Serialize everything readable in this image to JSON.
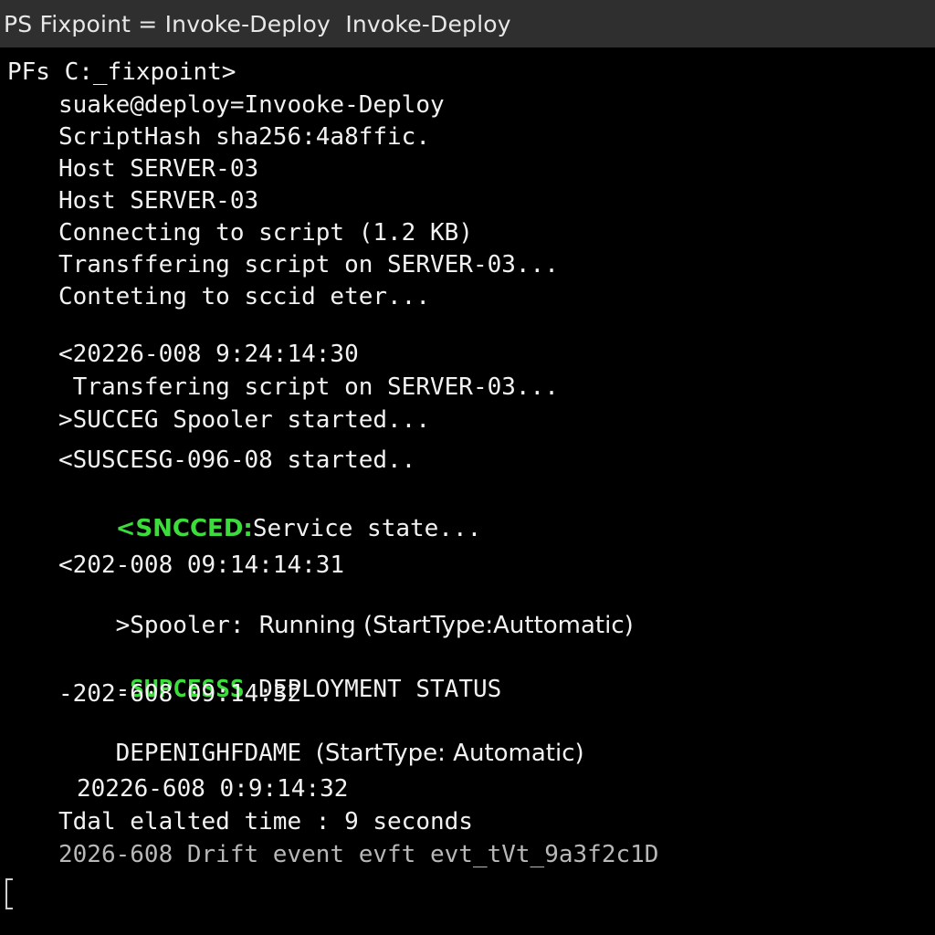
{
  "window": {
    "title": "PS Fixpoint = Invoke-Deploy  Invoke-Deploy"
  },
  "console": {
    "prompt": "PFs C:_fixpoint>",
    "lines": [
      "suake@deploy=Invooke-Deploy",
      "ScriptHash sha256:4a8ffic.",
      "Host SERVER-03",
      "Host SERVER-03",
      "Connecting to script (1.2 KB)",
      "Transffering script on SERVER-03...",
      "Conteting to sccid eter...",
      "<20226-008 9:24:14:30",
      " Transfering script on SERVER-03...",
      ">SUCCEG Spooler started...",
      "<SUSCESG-096-08 started..",
      "<SNCCED:",
      "Service state...",
      "<202-008 09:14:14:31",
      ">Spooler: ",
      "Running (StartType:Auttomatic)",
      "-",
      "SUPCESSS",
      " DEPLOYMENT STATUS",
      "-202-608 09:14:32",
      "DEPENIGHFDAME ",
      "(StartType: Automatic)",
      "20226-608 0:9:14:32",
      "Tdal elalted time : 9 seconds",
      "2026-608 Drift event evft evt_tVt_9a3f2c1D"
    ]
  },
  "colors": {
    "background": "#000000",
    "text": "#f2f2f2",
    "success": "#3ddc3d",
    "titlebar": "#2f2f2f"
  }
}
